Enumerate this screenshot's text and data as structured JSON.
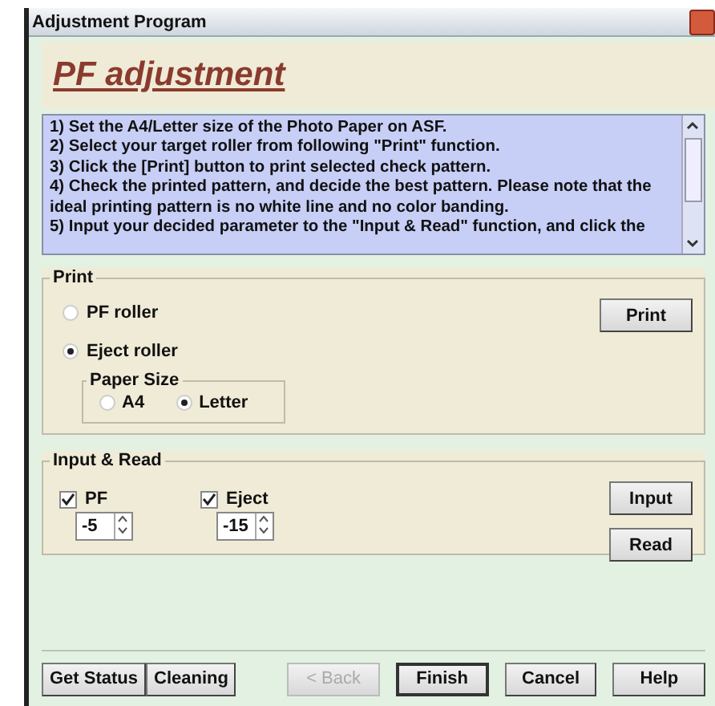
{
  "window": {
    "title": "Adjustment Program"
  },
  "heading": "PF adjustment",
  "instructions": [
    "1) Set the A4/Letter size of the Photo Paper on ASF.",
    "2) Select your target roller from following \"Print\" function.",
    "3) Click the [Print] button to print selected check pattern.",
    "4) Check the printed pattern, and decide the best pattern. Please note that the ideal printing pattern is no white line and no color banding.",
    "5) Input your decided parameter to the \"Input & Read\" function, and click the"
  ],
  "print": {
    "title": "Print",
    "rollers": [
      {
        "label": "PF roller",
        "selected": false
      },
      {
        "label": "Eject roller",
        "selected": true
      }
    ],
    "paper_size": {
      "title": "Paper Size",
      "options": [
        {
          "label": "A4",
          "selected": false
        },
        {
          "label": "Letter",
          "selected": true
        }
      ]
    },
    "button": "Print"
  },
  "input_read": {
    "title": "Input & Read",
    "items": [
      {
        "label": "PF",
        "checked": true,
        "value": "-5"
      },
      {
        "label": "Eject",
        "checked": true,
        "value": "-15"
      }
    ],
    "buttons": [
      "Input",
      "Read"
    ]
  },
  "footer": {
    "left_buttons": [
      {
        "label": "Get Status",
        "disabled": false
      },
      {
        "label": "Cleaning",
        "disabled": false
      }
    ],
    "right_buttons": [
      {
        "label": "< Back",
        "disabled": true
      },
      {
        "label": "Finish",
        "disabled": false,
        "default": true
      },
      {
        "label": "Cancel",
        "disabled": false
      },
      {
        "label": "Help",
        "disabled": false
      }
    ]
  }
}
